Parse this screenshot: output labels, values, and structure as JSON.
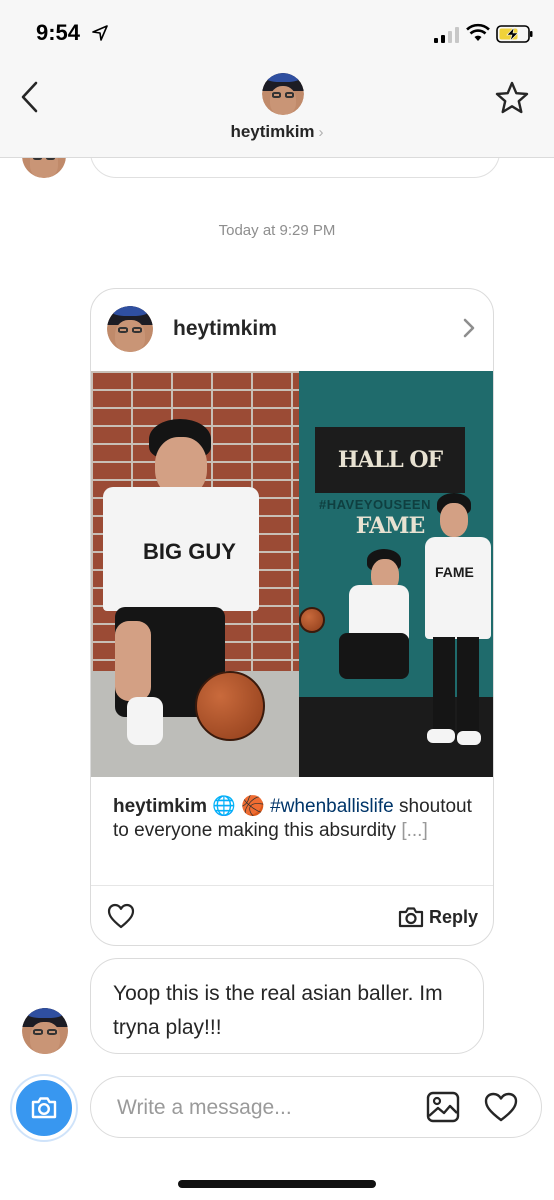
{
  "status_bar": {
    "time": "9:54"
  },
  "header": {
    "title": "heytimkim",
    "chevron": "›"
  },
  "conversation": {
    "timestamp": "Today at 9:29 PM",
    "shared_post": {
      "username": "heytimkim",
      "image_text": {
        "sign_main": "HALL OF FAME",
        "sign_tag": "#HAVEYOUSEEN",
        "shirt_left": "BIG GUY",
        "shirt_right": "FAME"
      },
      "caption": {
        "user": "heytimkim",
        "emojis": "🌐 🏀",
        "hashtag": "#whenballislife",
        "text": "shoutout to everyone making this absurdity",
        "more": "[...]"
      },
      "reply_label": "Reply"
    },
    "message": {
      "text": "Yoop this is the real asian baller. Im tryna play!!!"
    }
  },
  "composer": {
    "placeholder": "Write a message..."
  },
  "colors": {
    "accent": "#3897f0",
    "hashtag": "#003569",
    "border": "#dbdbdb"
  },
  "icons": [
    "location-arrow-icon",
    "signal-icon",
    "wifi-icon",
    "battery-charging-icon",
    "back-chevron-icon",
    "star-icon",
    "chevron-right-icon",
    "heart-icon",
    "camera-icon",
    "gallery-icon"
  ]
}
